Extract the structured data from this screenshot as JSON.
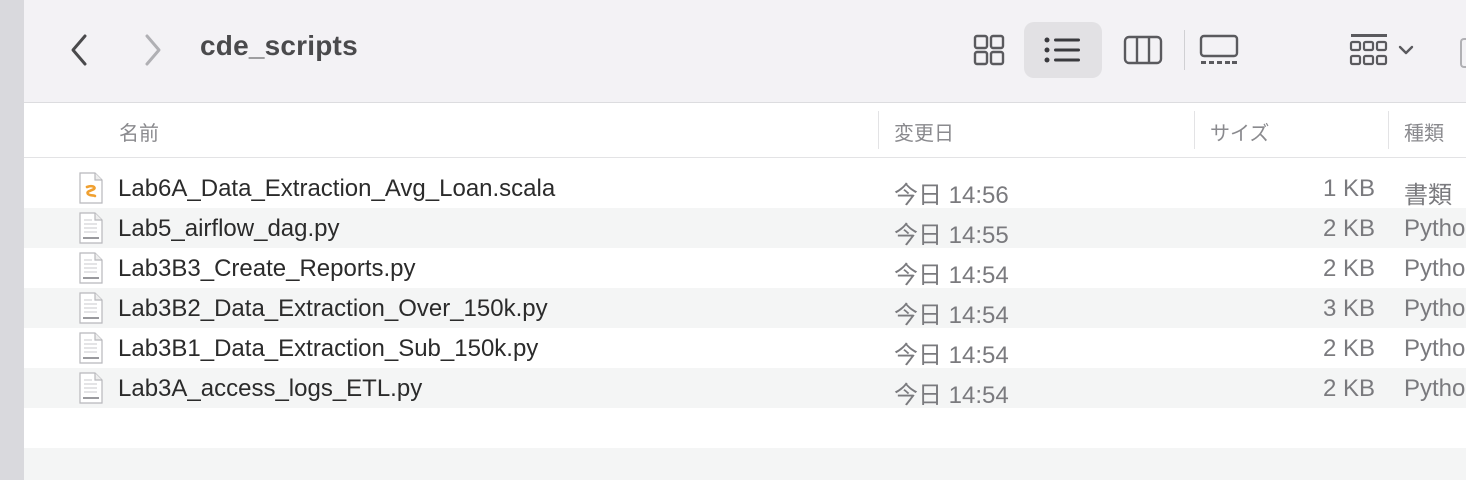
{
  "window": {
    "title": "cde_scripts",
    "back_icon": "chevron-left-icon",
    "forward_icon": "chevron-right-icon"
  },
  "toolbar": {
    "views": [
      {
        "name": "icon-view",
        "icon": "grid-icon",
        "active": false
      },
      {
        "name": "list-view",
        "icon": "list-icon",
        "active": true
      },
      {
        "name": "column-view",
        "icon": "columns-icon",
        "active": false
      },
      {
        "name": "gallery-view",
        "icon": "gallery-icon",
        "active": false
      }
    ],
    "group_icon": "group-by-icon"
  },
  "columns": {
    "name": "名前",
    "modified": "変更日",
    "size": "サイズ",
    "kind": "種類"
  },
  "files": [
    {
      "name": "Lab6A_Data_Extraction_Avg_Loan.scala",
      "modified": "今日 14:56",
      "size": "1 KB",
      "kind": "書類",
      "icon": "scala-file-icon"
    },
    {
      "name": "Lab5_airflow_dag.py",
      "modified": "今日 14:55",
      "size": "2 KB",
      "kind": "Pytho",
      "icon": "python-file-icon"
    },
    {
      "name": "Lab3B3_Create_Reports.py",
      "modified": "今日 14:54",
      "size": "2 KB",
      "kind": "Pytho",
      "icon": "python-file-icon"
    },
    {
      "name": "Lab3B2_Data_Extraction_Over_150k.py",
      "modified": "今日 14:54",
      "size": "3 KB",
      "kind": "Pytho",
      "icon": "python-file-icon"
    },
    {
      "name": "Lab3B1_Data_Extraction_Sub_150k.py",
      "modified": "今日 14:54",
      "size": "2 KB",
      "kind": "Pytho",
      "icon": "python-file-icon"
    },
    {
      "name": "Lab3A_access_logs_ETL.py",
      "modified": "今日 14:54",
      "size": "2 KB",
      "kind": "Pytho",
      "icon": "python-file-icon"
    }
  ],
  "colors": {
    "toolbar_bg": "#f3f2f5",
    "alt_row_bg": "#f4f5f5",
    "scala_accent": "#f0a030"
  }
}
